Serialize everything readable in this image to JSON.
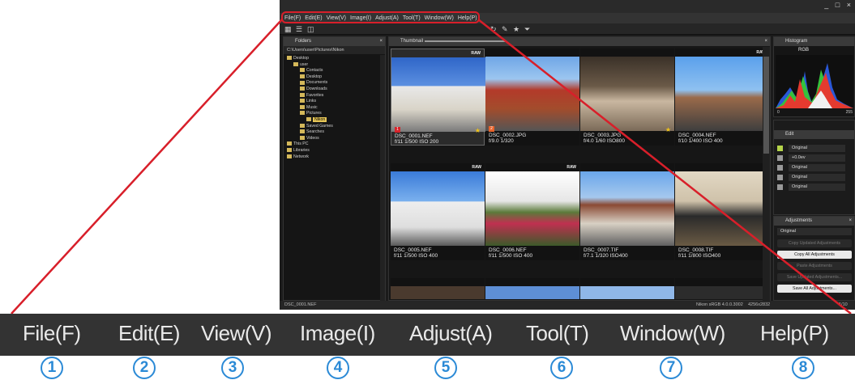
{
  "window": {
    "controls": "_ □ ×"
  },
  "menu": {
    "items": [
      "File(F)",
      "Edit(E)",
      "View(V)",
      "Image(I)",
      "Adjust(A)",
      "Tool(T)",
      "Window(W)",
      "Help(P)"
    ]
  },
  "folders": {
    "title": "Folders",
    "path": "C:\\Users\\user\\Pictures\\Nikon",
    "tree": [
      "Desktop",
      "user",
      "Contacts",
      "Desktop",
      "Documents",
      "Downloads",
      "Favorites",
      "Links",
      "Music",
      "Pictures",
      "Nikon",
      "Saved Games",
      "Searches",
      "Videos",
      "This PC",
      "Libraries",
      "Network"
    ],
    "selected": "Nikon"
  },
  "thumbnail": {
    "title": "Thumbnail",
    "raw_tag": "RAW",
    "items": [
      {
        "name": "DSC_0001.NEF",
        "meta": "f/11 1/500 ISO 200",
        "raw": true,
        "label": "1"
      },
      {
        "name": "DSC_0002.JPG",
        "meta": "f/9.0 1/320",
        "raw": false,
        "label": "2"
      },
      {
        "name": "DSC_0003.JPG",
        "meta": "f/4.0 1/60 ISO800",
        "raw": false,
        "label": ""
      },
      {
        "name": "DSC_0004.NEF",
        "meta": "f/10 1/400 ISO 400",
        "raw": true,
        "label": ""
      },
      {
        "name": "DSC_0005.NEF",
        "meta": "f/11 1/500 ISO 400",
        "raw": true,
        "label": ""
      },
      {
        "name": "DSC_0006.NEF",
        "meta": "f/11 1/500 ISO 400",
        "raw": true,
        "label": ""
      },
      {
        "name": "DSC_0007.TIF",
        "meta": "f/7.1 1/320 ISO400",
        "raw": false,
        "label": ""
      },
      {
        "name": "DSC_0008.TIF",
        "meta": "f/11 1/800 ISO400",
        "raw": false,
        "label": ""
      }
    ]
  },
  "histogram": {
    "title": "Histogram",
    "channel": "RGB",
    "min": "0",
    "max": "255"
  },
  "edit": {
    "title": "Edit",
    "rows": [
      "Original",
      "+0.0ev",
      "Original",
      "Original",
      "Original"
    ]
  },
  "adjustments": {
    "title": "Adjustments",
    "selected": "Original",
    "buttons": [
      {
        "label": "Copy Updated Adjustments",
        "enabled": false
      },
      {
        "label": "Copy All Adjustments",
        "enabled": true
      },
      {
        "label": "Paste Adjustments",
        "enabled": false
      },
      {
        "label": "Save Updated Adjustments...",
        "enabled": false
      },
      {
        "label": "Save All Adjustments...",
        "enabled": true
      }
    ]
  },
  "status": {
    "file": "DSC_0001.NEF",
    "profile": "Nikon sRGB 4.0.0.3002",
    "dimensions": "4256x2832",
    "page": "1/10"
  },
  "numbers": [
    "1",
    "2",
    "3",
    "4",
    "5",
    "6",
    "7",
    "8"
  ],
  "colors": {
    "callout": "#d81f2a",
    "number_circle": "#2b8ad6",
    "menubar": "#333333"
  }
}
